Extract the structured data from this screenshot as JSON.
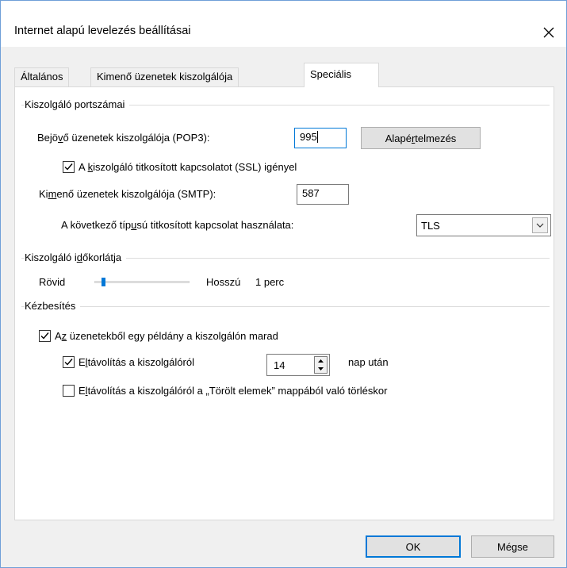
{
  "window": {
    "title": "Internet alapú levelezés beállításai"
  },
  "tabs": [
    {
      "label": "Általános"
    },
    {
      "label": "Kimenő üzenetek kiszolgálója"
    },
    {
      "label": "Speciális"
    }
  ],
  "ports": {
    "group_label": "Kiszolgáló portszámai",
    "incoming_label_pre": "Bejö",
    "incoming_label_u": "v",
    "incoming_label_post": "ő üzenetek kiszolgálója (POP3):",
    "incoming_value": "995",
    "default_button_pre": "Alapé",
    "default_button_u": "r",
    "default_button_post": "telmezés",
    "ssl_label_pre": "A ",
    "ssl_label_u": "k",
    "ssl_label_post": "iszolgáló titkosított kapcsolatot (SSL) igényel",
    "ssl_checked": true,
    "outgoing_label_pre": "Ki",
    "outgoing_label_u": "m",
    "outgoing_label_post": "enő üzenetek kiszolgálója (SMTP):",
    "outgoing_value": "587",
    "encryption_label_pre": "A következő típ",
    "encryption_label_u": "u",
    "encryption_label_post": "sú titkosított kapcsolat használata:",
    "encryption_value": "TLS"
  },
  "timeout": {
    "group_label_pre": "Kiszolgáló i",
    "group_label_u": "d",
    "group_label_post": "őkorlátja",
    "short_label": "Rövid",
    "long_label": "Hosszú",
    "value_text": "1 perc",
    "slider_level": 0.08
  },
  "delivery": {
    "group_label": "Kézbesítés",
    "leave_copy_label_pre": "A",
    "leave_copy_label_u": "z",
    "leave_copy_label_post": " üzenetekből egy példány a kiszolgálón marad",
    "leave_copy_checked": true,
    "remove_after_label_pre": "E",
    "remove_after_label_u": "l",
    "remove_after_label_post": "távolítás a kiszolgálóról",
    "remove_after_checked": true,
    "days_value": "14",
    "days_suffix": "nap után",
    "remove_deleted_label_pre": "E",
    "remove_deleted_label_u": "l",
    "remove_deleted_label_post": "távolítás a kiszolgálóról a „Törölt elemek” mappából való törléskor",
    "remove_deleted_checked": false
  },
  "footer": {
    "ok_label": "OK",
    "cancel_label": "Mégse"
  },
  "colors": {
    "accent": "#0078d7",
    "window_border": "#6f9fd8",
    "dialog_bg": "#f0f0f0"
  }
}
